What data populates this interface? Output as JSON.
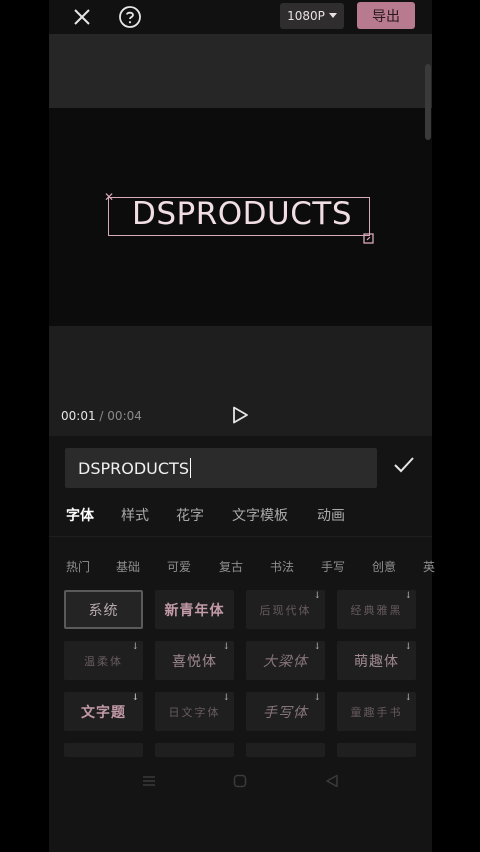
{
  "header": {
    "resolution": "1080P",
    "export_label": "导出"
  },
  "preview": {
    "text": "DSPRODUCTS",
    "current_time": "00:01",
    "separator": "/",
    "total_time": "00:04"
  },
  "editor": {
    "input_value": "DSPRODUCTS",
    "tabs": [
      "字体",
      "样式",
      "花字",
      "文字模板",
      "动画"
    ],
    "categories": [
      "热门",
      "基础",
      "可爱",
      "复古",
      "书法",
      "手写",
      "创意",
      "英"
    ],
    "fonts": [
      {
        "label": "系统"
      },
      {
        "label": "新青年体"
      },
      {
        "label": "后现代体"
      },
      {
        "label": "经典雅黑"
      },
      {
        "label": "温柔体"
      },
      {
        "label": "喜悦体"
      },
      {
        "label": "大梁体"
      },
      {
        "label": "萌趣体"
      },
      {
        "label": "文字题"
      },
      {
        "label": "日文字体"
      },
      {
        "label": "手写体"
      },
      {
        "label": "童趣手书"
      }
    ]
  },
  "colors": {
    "accent": "#b87a8f",
    "text_box": "#d9aab8",
    "panel": "#141414"
  },
  "icons": [
    "close-icon",
    "help-icon",
    "chevron-down-icon",
    "play-icon",
    "check-icon",
    "download-icon",
    "menu-icon",
    "home-icon",
    "back-icon"
  ]
}
